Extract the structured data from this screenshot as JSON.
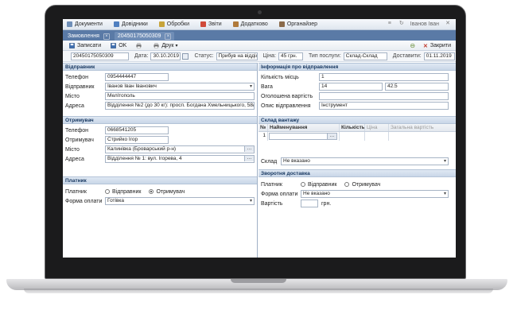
{
  "menu": {
    "items": [
      {
        "label": "Документи",
        "color": "#6f8fb8"
      },
      {
        "label": "Довідники",
        "color": "#4f7fc0"
      },
      {
        "label": "Обробки",
        "color": "#c7a43a"
      },
      {
        "label": "Звіти",
        "color": "#d04a3a"
      },
      {
        "label": "Додатково",
        "color": "#b07a3a"
      },
      {
        "label": "Органайзер",
        "color": "#8a6a4a"
      }
    ],
    "user": "Іванов Іван"
  },
  "tabs": [
    {
      "label": "Замовлення"
    },
    {
      "label": "20450175050309"
    }
  ],
  "toolbar": {
    "save_label": "Записати",
    "ok_label": "OK",
    "print_label": "Друк",
    "close_label": "Закрити"
  },
  "header": {
    "number": "20450175050309",
    "date_label": "Дата:",
    "date": "30.10.2019",
    "status_label": "Статус:",
    "status": "Прибув на відділ",
    "price_label": "Ціна:",
    "price": "45 грн.",
    "service_label": "Тип послуги:",
    "service": "Склад-Склад",
    "delivery_label": "Доставити:",
    "delivery": "01.11.2019"
  },
  "sender": {
    "title": "Відправник",
    "phone_label": "Телефон",
    "phone": "0954444447",
    "name_label": "Відправник",
    "name": "Іванов Іван Іванович",
    "city_label": "Місто",
    "city": "Мелітополь",
    "address_label": "Адреса",
    "address": "Відділення №2 (до 30 кг): просп. Богдана Хмельницького, 58/1"
  },
  "receiver": {
    "title": "Отримувач",
    "phone_label": "Телефон",
    "phone": "0668541205",
    "name_label": "Отримувач",
    "name": "Стрийко Ігор",
    "city_label": "Місто",
    "city": "Калинівка (Броварський р-н)",
    "address_label": "Адреса",
    "address": "Відділення № 1: вул. Ігорева, 4"
  },
  "payer": {
    "title": "Платник",
    "payer_label": "Платник",
    "opt_sender": "Відправник",
    "opt_receiver": "Отримувач",
    "selected": "receiver",
    "form_label": "Форма оплати",
    "form": "Готівка"
  },
  "shipment_info": {
    "title": "Інформація про відправлення",
    "places_label": "Кількість місць",
    "places": "1",
    "weight_label": "Вага",
    "weight": "14",
    "weight_volume": "42.5",
    "declared_label": "Оголошена вартість",
    "declared": "",
    "desc_label": "Опис відправлення",
    "desc": "Інструмент"
  },
  "cargo": {
    "title": "Склад вантажу",
    "columns": [
      "№",
      "Найменування",
      "Кількість",
      "Ціна",
      "Загальна вартість"
    ],
    "rows": [
      [
        "1",
        "",
        "",
        "",
        ""
      ]
    ],
    "warehouse_label": "Склад",
    "warehouse": "Не вказано"
  },
  "return_delivery": {
    "title": "Зворотня доставка",
    "payer_label": "Платник",
    "opt_sender": "Відправник",
    "opt_receiver": "Отримувач",
    "form_label": "Форма оплати",
    "form": "Не вказано",
    "cost_label": "Вартість",
    "cost": "",
    "currency": "грн."
  }
}
